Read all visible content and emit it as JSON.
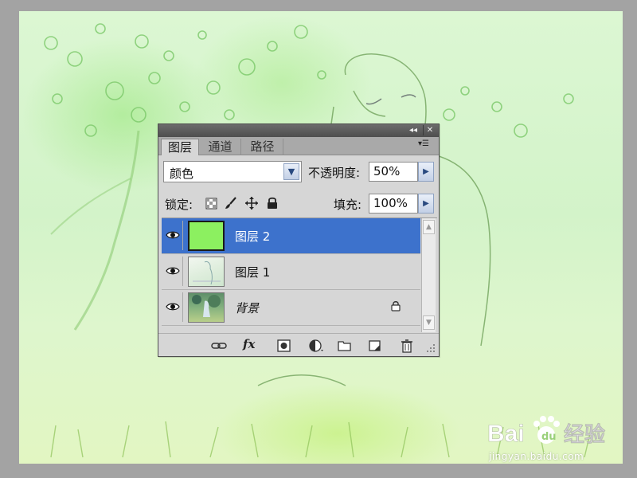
{
  "layers_panel": {
    "tabs": [
      {
        "label": "图层",
        "active": true
      },
      {
        "label": "通道",
        "active": false
      },
      {
        "label": "路径",
        "active": false
      }
    ],
    "blend_mode": "颜色",
    "opacity_label": "不透明度:",
    "opacity_value": "50%",
    "lock_label": "锁定:",
    "fill_label": "填充:",
    "fill_value": "100%",
    "layers": [
      {
        "name": "图层 2",
        "selected": true,
        "visible": true,
        "thumbnail": "solid-green",
        "locked": false
      },
      {
        "name": "图层 1",
        "selected": false,
        "visible": true,
        "thumbnail": "photo-sketch",
        "locked": false
      },
      {
        "name": "背景",
        "selected": false,
        "visible": true,
        "thumbnail": "photo",
        "locked": true
      }
    ],
    "icons": [
      "eye-icon",
      "link-icon",
      "fx-icon",
      "mask-icon",
      "adjustment-icon",
      "group-icon",
      "new-layer-icon",
      "trash-icon",
      "lock-icon"
    ],
    "fx_label": "fx"
  },
  "watermark": {
    "logo_text": "Bai度经验",
    "url": "jingyan.baidu.com"
  },
  "colors": {
    "selected_row": "#3d72cc",
    "layer2_fill": "#8cf060",
    "canvas_tint": "#d8f5cf"
  }
}
